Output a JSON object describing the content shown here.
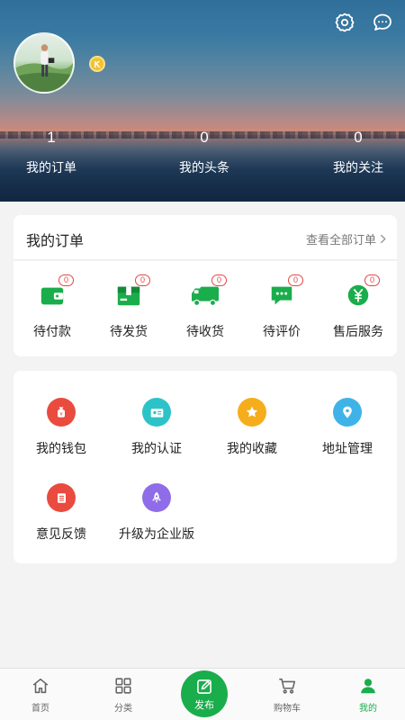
{
  "header": {
    "settings_icon": "gear-icon",
    "message_icon": "chat-bubble-icon",
    "vip_icon": "vip-k-badge-icon",
    "stats": [
      {
        "value": "1",
        "label": "我的订单"
      },
      {
        "value": "0",
        "label": "我的头条"
      },
      {
        "value": "0",
        "label": "我的关注"
      }
    ]
  },
  "orders": {
    "title": "我的订单",
    "view_all": "查看全部订单",
    "items": [
      {
        "label": "待付款",
        "count": "0",
        "icon": "wallet-icon"
      },
      {
        "label": "待发货",
        "count": "0",
        "icon": "package-icon"
      },
      {
        "label": "待收货",
        "count": "0",
        "icon": "truck-icon"
      },
      {
        "label": "待评价",
        "count": "0",
        "icon": "comment-icon"
      },
      {
        "label": "售后服务",
        "count": "0",
        "icon": "yuan-service-icon"
      }
    ]
  },
  "services": {
    "items": [
      {
        "label": "我的钱包",
        "icon": "money-bag-icon",
        "color": "#ea4b3f"
      },
      {
        "label": "我的认证",
        "icon": "id-card-icon",
        "color": "#2cc3c8"
      },
      {
        "label": "我的收藏",
        "icon": "star-icon",
        "color": "#f6ad1b"
      },
      {
        "label": "地址管理",
        "icon": "location-pin-icon",
        "color": "#3fb3e8"
      },
      {
        "label": "意见反馈",
        "icon": "feedback-list-icon",
        "color": "#ea4b3f"
      },
      {
        "label": "升级为企业版",
        "icon": "rocket-icon",
        "color": "#8f6ce8"
      }
    ]
  },
  "tabbar": {
    "items": [
      {
        "label": "首页",
        "icon": "home-icon",
        "active": false
      },
      {
        "label": "分类",
        "icon": "grid-icon",
        "active": false
      },
      {
        "label": "发布",
        "icon": "edit-icon",
        "active": false
      },
      {
        "label": "购物车",
        "icon": "cart-icon",
        "active": false
      },
      {
        "label": "我的",
        "icon": "user-icon",
        "active": true
      }
    ]
  },
  "colors": {
    "accent": "#1aad4b",
    "badge": "#e04848"
  }
}
